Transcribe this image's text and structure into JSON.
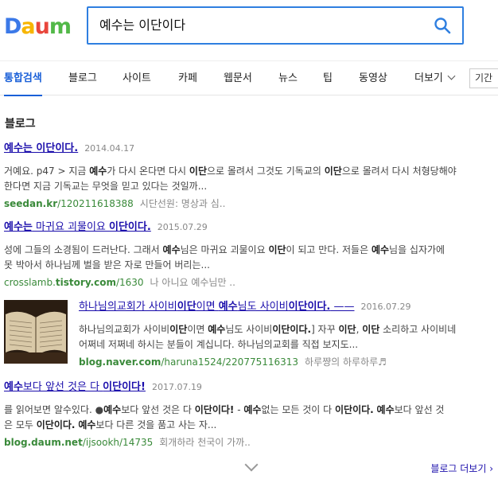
{
  "search": {
    "query": "예수는 이단이다"
  },
  "colors": {
    "accent": "#1a60d8",
    "link": "#1a0dab",
    "url": "#3a8a3a"
  },
  "tabs": [
    {
      "label": "통합검색"
    },
    {
      "label": "블로그"
    },
    {
      "label": "사이트"
    },
    {
      "label": "카페"
    },
    {
      "label": "웹문서"
    },
    {
      "label": "뉴스"
    },
    {
      "label": "팁"
    },
    {
      "label": "동영상"
    },
    {
      "label": "더보기"
    }
  ],
  "period_label": "기간",
  "section_title": "블로그",
  "results": [
    {
      "title_pre": "",
      "title_hl": "예수는 이단이다.",
      "title_post": "",
      "date": "2014.04.17",
      "line1": [
        "거예요. p47 > 지금 ",
        "예수",
        "가 다시 온다면 다시 ",
        "이단",
        "으로 몰려서 그것도 기독교의 ",
        "이단",
        "으로 몰려서 다시 처형당해야"
      ],
      "line2": [
        "한다면 지금 기독교는 무엇을 믿고 있다는 것일까...",
        "",
        ""
      ],
      "url_bold": "seedan.kr",
      "url_rest": "/120211618388",
      "cafe": "시단선원: 명상과 심.."
    },
    {
      "title_pre": "",
      "title_hl": "예수는",
      "title_post": " 마귀요 괴물이요 ",
      "title_hl2": "이단이다.",
      "date": "2015.07.29",
      "line1": [
        "성에 그들의 소경됨이 드러난다. 그래서 ",
        "예수",
        "님은 마귀요 괴물이요 ",
        "이단",
        "이 되고 만다. 저들은 ",
        "예수",
        "님을 십자가에"
      ],
      "line2": [
        "못 박아서 하나님께 벌을 받은 자로 만들어 버리는...",
        "",
        ""
      ],
      "url_bold": "crosslamb.",
      "url_bold2": "tistory.com",
      "url_rest": "/1630",
      "cafe": "나 아니요 예수님만 .."
    },
    {
      "title_pre": "하나님의교회가 사이비",
      "title_hl": "이단",
      "title_post": "이면 ",
      "title_hl2": "예수",
      "title_post2": "님도 사이비",
      "title_hl3": "이단이다.",
      "title_post3": " ——",
      "date": "2016.07.29",
      "line1": [
        "하나님의교회가 사이비",
        "이단",
        "이면 ",
        "예수",
        "님도 사이비",
        "이단이다.",
        "] 자꾸 ",
        "이단",
        ", ",
        "이단",
        " 소리하고 사이비네"
      ],
      "line2": [
        "어쩌네 저쩌네 하시는 분들이 계십니다. 하나님의교회를 직접 보지도...",
        "",
        ""
      ],
      "url_bold": "blog.naver.com",
      "url_rest": "/haruna1524/220775116313",
      "cafe": "하루쨩의 하루하루♬"
    },
    {
      "title_pre": "",
      "title_hl": "예수",
      "title_post": "보다 앞선 것은 다 ",
      "title_hl2": "이단이다!",
      "date": "2017.07.19",
      "line1": [
        "를 읽어보면 알수있다. ●",
        "예수",
        "보다 앞선 것은 다 ",
        "이단이다!",
        " - ",
        "예수",
        "없는 모든 것이 다 ",
        "이단이다.",
        " ",
        "예수",
        "보다 앞선 것"
      ],
      "line2": [
        "은 모두 ",
        "이단이다.",
        " ",
        "예수",
        "보다 다른 것을 품고 사는 자...",
        "",
        ""
      ],
      "url_bold": "blog.daum.net",
      "url_rest": "/ijsookh/14735",
      "cafe": "회개하라 천국이 가까.."
    }
  ],
  "more_label": "블로그 더보기 ›"
}
